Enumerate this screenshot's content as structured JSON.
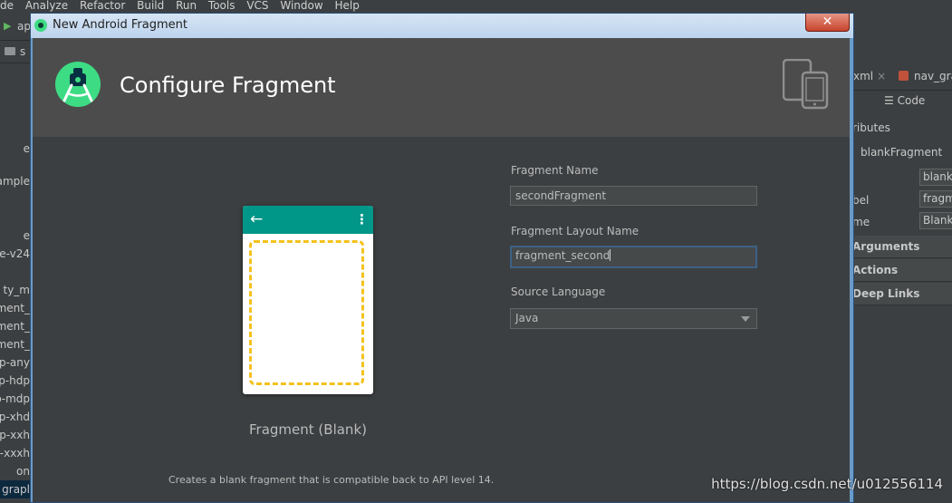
{
  "ide": {
    "menu": [
      "de",
      "Analyze",
      "Refactor",
      "Build",
      "Run",
      "Tools",
      "VCS",
      "Window",
      "Help"
    ],
    "toolbar_text": "app",
    "nav_text": "s",
    "tree_items": [
      {
        "label": "e",
        "top": 0
      },
      {
        "label": "ample",
        "top": 0
      },
      {
        "label": "e",
        "top": 0
      },
      {
        "label": "e-v24",
        "top": 0
      },
      {
        "label": "ty_m",
        "top": 0
      },
      {
        "label": "ment_",
        "top": 0
      },
      {
        "label": "ment_",
        "top": 0
      },
      {
        "label": "ment_",
        "top": 0
      },
      {
        "label": "p-any",
        "top": 0
      },
      {
        "label": "p-hdp",
        "top": 0
      },
      {
        "label": "p-mdp",
        "top": 0
      },
      {
        "label": "p-xhd",
        "top": 0
      },
      {
        "label": "p-xxh",
        "top": 0
      },
      {
        "label": "p-xxxh",
        "top": 0
      },
      {
        "label": "on",
        "top": 0
      },
      {
        "label": "grapl",
        "top": 0
      }
    ],
    "right_panel": {
      "tab_xml": "xml",
      "tab_close": "×",
      "tab_nav": "nav_gra",
      "code_label": "Code",
      "attributes": "ributes",
      "fragment_name": "blankFragment",
      "row1_value": "blank",
      "row2_label": "bel",
      "row2_value": "fragm",
      "row3_label": "me",
      "row3_value": "Blank",
      "sections": [
        "Arguments",
        "Actions",
        "Deep Links"
      ]
    },
    "watermark": "https://blog.csdn.net/u012556114"
  },
  "dialog": {
    "window_title": "New Android Fragment",
    "close_label": "✕",
    "header_title": "Configure Fragment",
    "template_label": "Fragment (Blank)",
    "template_description": "Creates a blank fragment that is compatible back to API level 14.",
    "preview": {
      "back_icon": "←",
      "more_icon": "⋮"
    },
    "fields": {
      "fragment_name_label": "Fragment Name",
      "fragment_name_value": "secondFragment",
      "layout_name_label": "Fragment Layout Name",
      "layout_name_value": "fragment_second",
      "source_language_label": "Source Language",
      "source_language_value": "Java"
    },
    "colors": {
      "android_green": "#3ddc84",
      "preview_toolbar": "#009688",
      "dashed_frame": "#f4c21d"
    }
  }
}
